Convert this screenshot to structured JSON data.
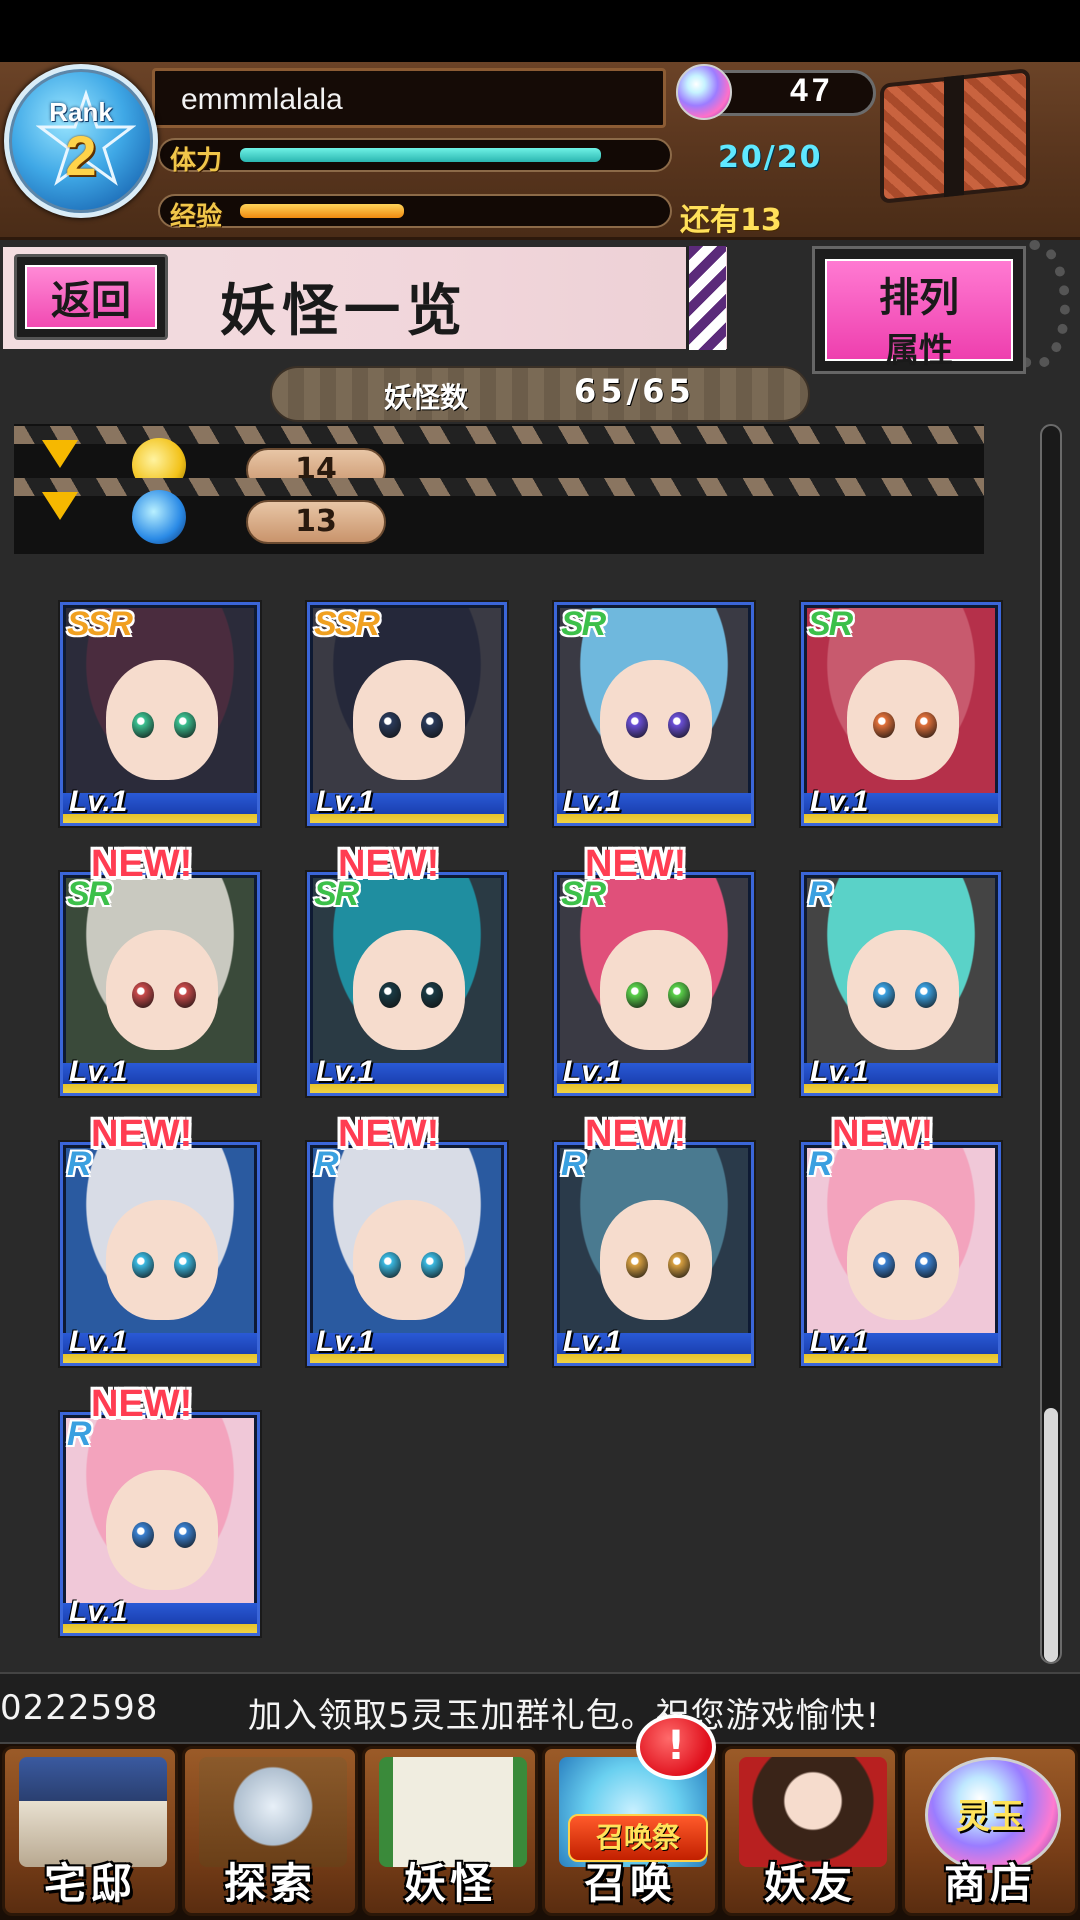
{
  "header": {
    "rank_word": "Rank",
    "rank_number": "2",
    "player_name": "emmmlalala",
    "stamina_label": "体力",
    "stamina_value": "20/20",
    "stamina_fraction": 0.88,
    "exp_label": "经验",
    "exp_remaining": "还有13",
    "exp_fraction": 0.4,
    "gems": "47"
  },
  "title_bar": {
    "back_label": "返回",
    "title": "妖怪一览",
    "sort_line1": "排列",
    "sort_line2": "属性"
  },
  "count": {
    "label": "妖怪数",
    "value": "65/65"
  },
  "filters": [
    {
      "icon": "gold-element-icon",
      "count": "14"
    },
    {
      "icon": "water-element-icon",
      "count": "13"
    }
  ],
  "cards": [
    {
      "rarity": "SSR",
      "level": "Lv.1",
      "new": "",
      "hair": "#4a2c3e",
      "eye": "#3bbf8f",
      "bg": "#2b2b3a"
    },
    {
      "rarity": "SSR",
      "level": "Lv.1",
      "new": "",
      "hair": "#25283a",
      "eye": "#2a3a5a",
      "bg": "#3a3a44"
    },
    {
      "rarity": "SR",
      "level": "Lv.1",
      "new": "",
      "hair": "#6fb8dd",
      "eye": "#6a4fd6",
      "bg": "#3a3a44"
    },
    {
      "rarity": "SR",
      "level": "Lv.1",
      "new": "",
      "hair": "#c85a6e",
      "eye": "#e0703a",
      "bg": "#b5304a"
    },
    {
      "rarity": "SR",
      "level": "Lv.1",
      "new": "NEW!",
      "hair": "#c9c9c0",
      "eye": "#c84a4a",
      "bg": "#3a4a3a"
    },
    {
      "rarity": "SR",
      "level": "Lv.1",
      "new": "NEW!",
      "hair": "#1f8ea0",
      "eye": "#1a3a44",
      "bg": "#2a3a44"
    },
    {
      "rarity": "SR",
      "level": "Lv.1",
      "new": "NEW!",
      "hair": "#e0507a",
      "eye": "#5ad04a",
      "bg": "#3a3a44"
    },
    {
      "rarity": "R",
      "level": "Lv.1",
      "new": "",
      "hair": "#5ad2c8",
      "eye": "#3aa0e0",
      "bg": "#444444"
    },
    {
      "rarity": "R",
      "level": "Lv.1",
      "new": "NEW!",
      "hair": "#d8dce6",
      "eye": "#3ab8e0",
      "bg": "#2a5aa0"
    },
    {
      "rarity": "R",
      "level": "Lv.1",
      "new": "NEW!",
      "hair": "#d8dce6",
      "eye": "#3ab8e0",
      "bg": "#2a5aa0"
    },
    {
      "rarity": "R",
      "level": "Lv.1",
      "new": "NEW!",
      "hair": "#4a7a90",
      "eye": "#d8a040",
      "bg": "#2a3a4a"
    },
    {
      "rarity": "R",
      "level": "Lv.1",
      "new": "NEW!",
      "hair": "#f3a3bd",
      "eye": "#3a80d0",
      "bg": "#f0c8d8"
    },
    {
      "rarity": "R",
      "level": "Lv.1",
      "new": "NEW!",
      "hair": "#f3a3bd",
      "eye": "#3a80d0",
      "bg": "#f0c8d8"
    }
  ],
  "ticker": {
    "left": "0222598",
    "message": "加入领取5灵玉加群礼包。祝您游戏愉快!"
  },
  "nav": [
    {
      "label": "宅邸",
      "icon": "mansion-icon"
    },
    {
      "label": "探索",
      "icon": "explore-magnifier-icon"
    },
    {
      "label": "妖怪",
      "icon": "yokai-scroll-icon"
    },
    {
      "label": "召唤",
      "icon": "summon-icon",
      "banner": "召唤祭",
      "alert": "!"
    },
    {
      "label": "妖友",
      "icon": "friends-icon"
    },
    {
      "label": "商店",
      "icon": "shop-orb-icon",
      "overlay": "灵玉"
    }
  ]
}
